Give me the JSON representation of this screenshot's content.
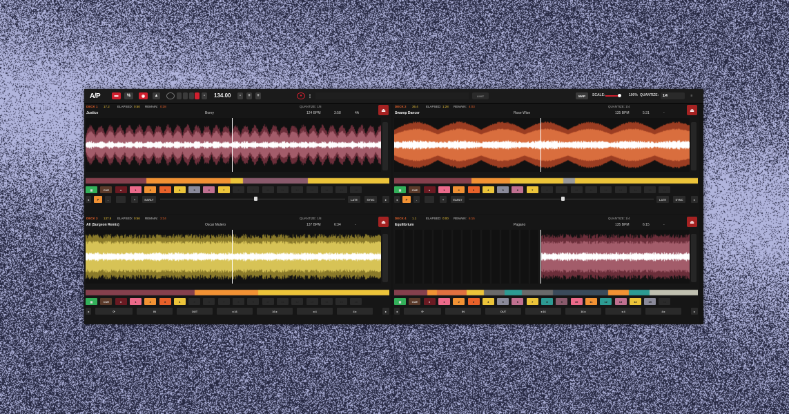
{
  "colors": {
    "accent": "#e8612a",
    "record": "#d01f2e",
    "maroon": "#85404d",
    "orange": "#f29234",
    "gold": "#ecc43a",
    "green": "#33b05a",
    "mauve": "#8a5a6c",
    "grey": "#6a6a6a",
    "teal": "#2d9b93"
  },
  "toolbar": {
    "logo": "A/P",
    "bpm": "134.00",
    "map_label": "MAP",
    "scale_label": "SCALE:",
    "scale_value": "100%",
    "quantize_label": "QUANTIZE:",
    "quantize_value": "1/4",
    "limit_label": "LIMIT",
    "icons": [
      "folder-icon",
      "grid-icon",
      "record-icon",
      "metronome-icon",
      "dial-icon",
      "stop-icon",
      "minus-icon",
      "plus-icon",
      "power-icon",
      "more-icon"
    ]
  },
  "decks": [
    {
      "label": "DECK 1",
      "loop": "17.2",
      "elapsed_label": "ELAPSED:",
      "elapsed": "0:50",
      "remain_label": "REMAIN:",
      "remain": "0:38",
      "quantize": "QUANTIZE: 1/8",
      "title": "Justice",
      "artist": "Borey",
      "bpm": "124 BPM",
      "time": "3:58",
      "key": "4A",
      "wave": "maroon"
    },
    {
      "label": "DECK 2",
      "loop": "36.4",
      "elapsed_label": "ELAPSED:",
      "elapsed": "1:28",
      "remain_label": "REMAIN:",
      "remain": "4:03",
      "quantize": "QUANTIZE: 1/4",
      "title": "Swamp Dancer",
      "artist": "Rose Wise",
      "bpm": "135 BPM",
      "time": "5:31",
      "key": "-",
      "wave": "orange"
    },
    {
      "label": "DECK 3",
      "loop": "137.5",
      "elapsed_label": "ELAPSED:",
      "elapsed": "0:56",
      "remain_label": "REMAIN:",
      "remain": "3:34",
      "quantize": "QUANTIZE: 1/8",
      "title": "All (Surgeon Remix)",
      "artist": "Oscar Mulero",
      "bpm": "137 BPM",
      "time": "6:34",
      "key": "-",
      "wave": "gold"
    },
    {
      "label": "DECK 4",
      "loop": "1.1",
      "elapsed_label": "ELAPSED:",
      "elapsed": "0:00",
      "remain_label": "REMAIN:",
      "remain": "6:15",
      "quantize": "QUANTIZE: 1/4",
      "title": "Equilibrium",
      "artist": "Pagano",
      "bpm": "135 BPM",
      "time": "6:15",
      "key": "-",
      "wave": "maroon"
    }
  ],
  "pads": {
    "cue": "CUE",
    "numbers": [
      "1",
      "2",
      "3",
      "4",
      "5",
      "6",
      "7",
      "8",
      "9",
      "10",
      "11",
      "12",
      "13",
      "14",
      "15",
      "16"
    ]
  },
  "nudge": {
    "early": "EARLY",
    "late": "LATE",
    "sync": "SYNC",
    "p": "P"
  },
  "loop": {
    "in": "IN",
    "out": "OUT",
    "back16": "◂ 16",
    "fwd16": "16 ▸",
    "back4": "◂ 4",
    "fwd4": "4 ▸"
  }
}
